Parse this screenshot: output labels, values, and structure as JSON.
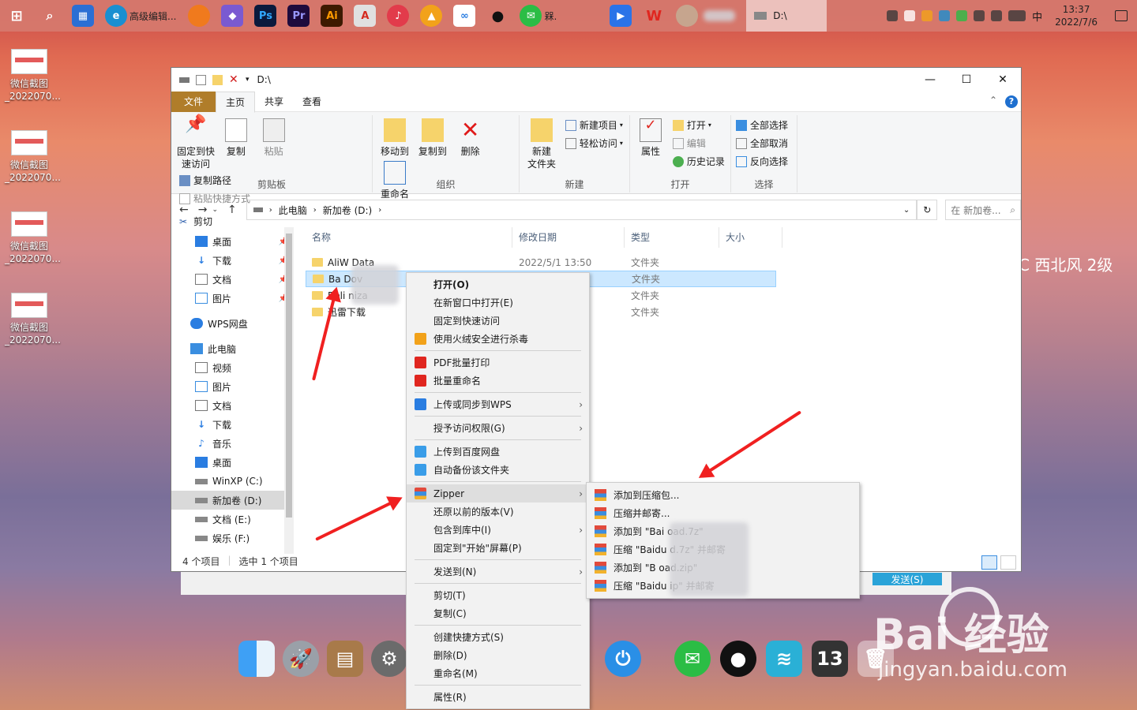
{
  "taskbar": {
    "apps": [
      {
        "name": "browser-edge",
        "label": "高级编辑..."
      },
      {
        "name": "wechat",
        "label": "槑."
      }
    ],
    "active_window": "D:\\",
    "ime": "中",
    "time": "13:37",
    "date": "2022/7/6"
  },
  "desktop": {
    "icons": [
      {
        "label1": "微信截图",
        "label2": "_2022070..."
      },
      {
        "label1": "微信截图",
        "label2": "_2022070..."
      },
      {
        "label1": "微信截图",
        "label2": "_2022070..."
      },
      {
        "label1": "微信截图",
        "label2": "_2022070..."
      }
    ],
    "weather": "C  西北风  2级",
    "watermark_brand": "Bai  经验",
    "watermark_url": "jingyan.baidu.com",
    "dock_number": "13"
  },
  "explorer": {
    "title": "D:\\",
    "tabs": [
      "文件",
      "主页",
      "共享",
      "查看"
    ],
    "ribbon": {
      "clipboard": {
        "label": "剪贴板",
        "pin": "固定到快\n速访问",
        "copy": "复制",
        "paste": "粘贴",
        "copy_path": "复制路径",
        "paste_shortcut": "粘贴快捷方式",
        "cut": "剪切"
      },
      "organize": {
        "label": "组织",
        "move_to": "移动到",
        "copy_to": "复制到",
        "delete": "删除",
        "rename": "重命名"
      },
      "new": {
        "label": "新建",
        "new_folder": "新建\n文件夹",
        "new_item": "新建项目",
        "easy_access": "轻松访问"
      },
      "open": {
        "label": "打开",
        "properties": "属性",
        "open": "打开",
        "edit": "编辑",
        "history": "历史记录"
      },
      "select": {
        "label": "选择",
        "select_all": "全部选择",
        "select_none": "全部取消",
        "invert": "反向选择"
      }
    },
    "address": {
      "this_pc": "此电脑",
      "drive": "新加卷 (D:)",
      "search_placeholder": "在 新加卷..."
    },
    "nav": [
      {
        "label": "桌面",
        "pinned": true
      },
      {
        "label": "下载",
        "pinned": true
      },
      {
        "label": "文档",
        "pinned": true
      },
      {
        "label": "图片",
        "pinned": true
      },
      {
        "label": "WPS网盘"
      },
      {
        "label": "此电脑"
      },
      {
        "label": "视频"
      },
      {
        "label": "图片"
      },
      {
        "label": "文档"
      },
      {
        "label": "下载"
      },
      {
        "label": "音乐"
      },
      {
        "label": "桌面"
      },
      {
        "label": "WinXP (C:)"
      },
      {
        "label": "新加卷 (D:)",
        "selected": true
      },
      {
        "label": "文档 (E:)"
      },
      {
        "label": "娱乐 (F:)"
      }
    ],
    "columns": [
      "名称",
      "修改日期",
      "类型",
      "大小"
    ],
    "files": [
      {
        "name": "AliW      Data",
        "date": "2022/5/1 13:50",
        "type": "文件夹"
      },
      {
        "name": "Ba         Dov",
        "date": "",
        "type": "文件夹",
        "selected": true
      },
      {
        "name": "Beli         niza",
        "date": "",
        "type": "文件夹"
      },
      {
        "name": "迅雷下载",
        "date": "",
        "type": "文件夹"
      }
    ],
    "status": {
      "count": "4 个项目",
      "selected": "选中 1 个项目"
    }
  },
  "context_menu": {
    "items": [
      {
        "label": "打开(O)",
        "bold": true
      },
      {
        "label": "在新窗口中打开(E)"
      },
      {
        "label": "固定到快速访问"
      },
      {
        "label": "使用火绒安全进行杀毒",
        "icon": "huorong-icon"
      },
      {
        "sep": true
      },
      {
        "label": "PDF批量打印",
        "icon": "wps-icon"
      },
      {
        "label": "批量重命名",
        "icon": "wps-icon"
      },
      {
        "sep": true
      },
      {
        "label": "上传或同步到WPS",
        "icon": "wps-cloud-icon",
        "sub": true
      },
      {
        "sep": true
      },
      {
        "label": "授予访问权限(G)",
        "sub": true
      },
      {
        "sep": true
      },
      {
        "label": "上传到百度网盘",
        "icon": "baidu-netdisk-icon"
      },
      {
        "label": "自动备份该文件夹",
        "icon": "baidu-netdisk-icon"
      },
      {
        "sep": true
      },
      {
        "label": "Zipper",
        "icon": "zipper-icon",
        "sub": true,
        "highlight": true
      },
      {
        "label": "还原以前的版本(V)"
      },
      {
        "label": "包含到库中(I)",
        "sub": true
      },
      {
        "label": "固定到\"开始\"屏幕(P)"
      },
      {
        "sep": true
      },
      {
        "label": "发送到(N)",
        "sub": true
      },
      {
        "sep": true
      },
      {
        "label": "剪切(T)"
      },
      {
        "label": "复制(C)"
      },
      {
        "sep": true
      },
      {
        "label": "创建快捷方式(S)"
      },
      {
        "label": "删除(D)"
      },
      {
        "label": "重命名(M)"
      },
      {
        "sep": true
      },
      {
        "label": "属性(R)"
      }
    ]
  },
  "submenu": {
    "items": [
      "添加到压缩包...",
      "压缩并邮寄...",
      "添加到 \"Bai          oad.7z\"",
      "压缩 \"Baidu          d.7z\" 并邮寄",
      "添加到 \"B          oad.zip\"",
      "压缩 \"Baidu          ip\" 并邮寄"
    ]
  },
  "back_dialog": {
    "button": "发送(S)"
  }
}
